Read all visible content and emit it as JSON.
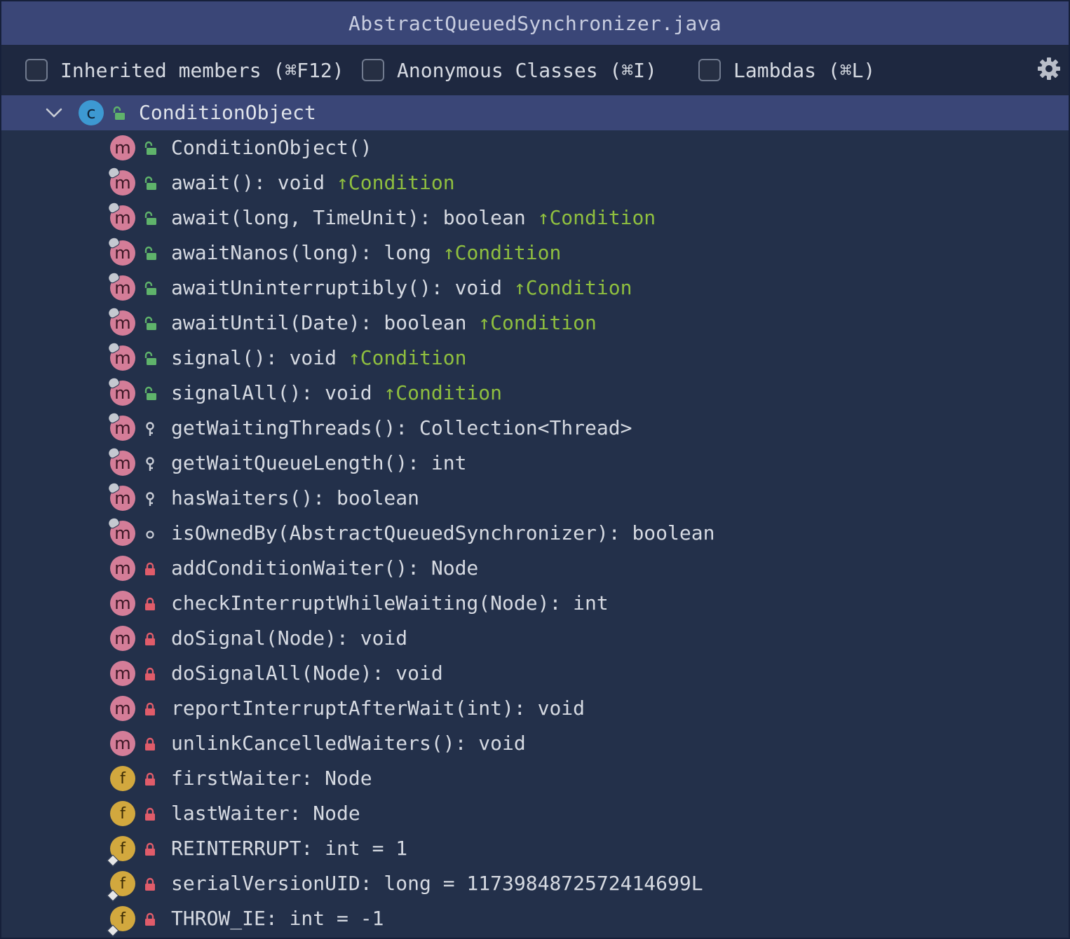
{
  "window": {
    "title": "AbstractQueuedSynchronizer.java"
  },
  "toolbar": {
    "inherited_label": "Inherited members (⌘F12)",
    "anonymous_label": "Anonymous Classes (⌘I)",
    "lambdas_label": "Lambdas (⌘L)",
    "inherited_checked": false,
    "anonymous_checked": false,
    "lambdas_checked": false,
    "settings_icon": "gear-icon"
  },
  "colors": {
    "method_badge": "#d47d98",
    "field_badge": "#d2a83e",
    "class_badge": "#3d99d2",
    "public": "#5fb36b",
    "private": "#e05c6a",
    "inherited": "#8fbf3f",
    "selected_row": "#3a4677"
  },
  "tree": {
    "root": {
      "name": "ConditionObject",
      "kind_letter": "c",
      "visibility": "public",
      "expanded": true,
      "selected": true
    },
    "members": [
      {
        "kind": "m",
        "name": "ConditionObject()",
        "visibility": "public",
        "overrides": false,
        "final": false,
        "inherited": ""
      },
      {
        "kind": "m",
        "name": "await(): void",
        "visibility": "public",
        "overrides": true,
        "final": false,
        "inherited": "↑Condition"
      },
      {
        "kind": "m",
        "name": "await(long, TimeUnit): boolean",
        "visibility": "public",
        "overrides": true,
        "final": false,
        "inherited": "↑Condition"
      },
      {
        "kind": "m",
        "name": "awaitNanos(long): long",
        "visibility": "public",
        "overrides": true,
        "final": false,
        "inherited": "↑Condition"
      },
      {
        "kind": "m",
        "name": "awaitUninterruptibly(): void",
        "visibility": "public",
        "overrides": true,
        "final": false,
        "inherited": "↑Condition"
      },
      {
        "kind": "m",
        "name": "awaitUntil(Date): boolean",
        "visibility": "public",
        "overrides": true,
        "final": false,
        "inherited": "↑Condition"
      },
      {
        "kind": "m",
        "name": "signal(): void",
        "visibility": "public",
        "overrides": true,
        "final": false,
        "inherited": "↑Condition"
      },
      {
        "kind": "m",
        "name": "signalAll(): void",
        "visibility": "public",
        "overrides": true,
        "final": false,
        "inherited": "↑Condition"
      },
      {
        "kind": "m",
        "name": "getWaitingThreads(): Collection<Thread>",
        "visibility": "protected",
        "overrides": true,
        "final": false,
        "inherited": ""
      },
      {
        "kind": "m",
        "name": "getWaitQueueLength(): int",
        "visibility": "protected",
        "overrides": true,
        "final": false,
        "inherited": ""
      },
      {
        "kind": "m",
        "name": "hasWaiters(): boolean",
        "visibility": "protected",
        "overrides": true,
        "final": false,
        "inherited": ""
      },
      {
        "kind": "m",
        "name": "isOwnedBy(AbstractQueuedSynchronizer): boolean",
        "visibility": "package",
        "overrides": true,
        "final": false,
        "inherited": ""
      },
      {
        "kind": "m",
        "name": "addConditionWaiter(): Node",
        "visibility": "private",
        "overrides": false,
        "final": false,
        "inherited": ""
      },
      {
        "kind": "m",
        "name": "checkInterruptWhileWaiting(Node): int",
        "visibility": "private",
        "overrides": false,
        "final": false,
        "inherited": ""
      },
      {
        "kind": "m",
        "name": "doSignal(Node): void",
        "visibility": "private",
        "overrides": false,
        "final": false,
        "inherited": ""
      },
      {
        "kind": "m",
        "name": "doSignalAll(Node): void",
        "visibility": "private",
        "overrides": false,
        "final": false,
        "inherited": ""
      },
      {
        "kind": "m",
        "name": "reportInterruptAfterWait(int): void",
        "visibility": "private",
        "overrides": false,
        "final": false,
        "inherited": ""
      },
      {
        "kind": "m",
        "name": "unlinkCancelledWaiters(): void",
        "visibility": "private",
        "overrides": false,
        "final": false,
        "inherited": ""
      },
      {
        "kind": "f",
        "name": "firstWaiter: Node",
        "visibility": "private",
        "overrides": false,
        "final": false,
        "inherited": ""
      },
      {
        "kind": "f",
        "name": "lastWaiter: Node",
        "visibility": "private",
        "overrides": false,
        "final": false,
        "inherited": ""
      },
      {
        "kind": "f",
        "name": "REINTERRUPT: int = 1",
        "visibility": "private",
        "overrides": false,
        "final": true,
        "inherited": ""
      },
      {
        "kind": "f",
        "name": "serialVersionUID: long = 1173984872572414699L",
        "visibility": "private",
        "overrides": false,
        "final": true,
        "inherited": ""
      },
      {
        "kind": "f",
        "name": "THROW_IE: int = -1",
        "visibility": "private",
        "overrides": false,
        "final": true,
        "inherited": ""
      }
    ]
  }
}
